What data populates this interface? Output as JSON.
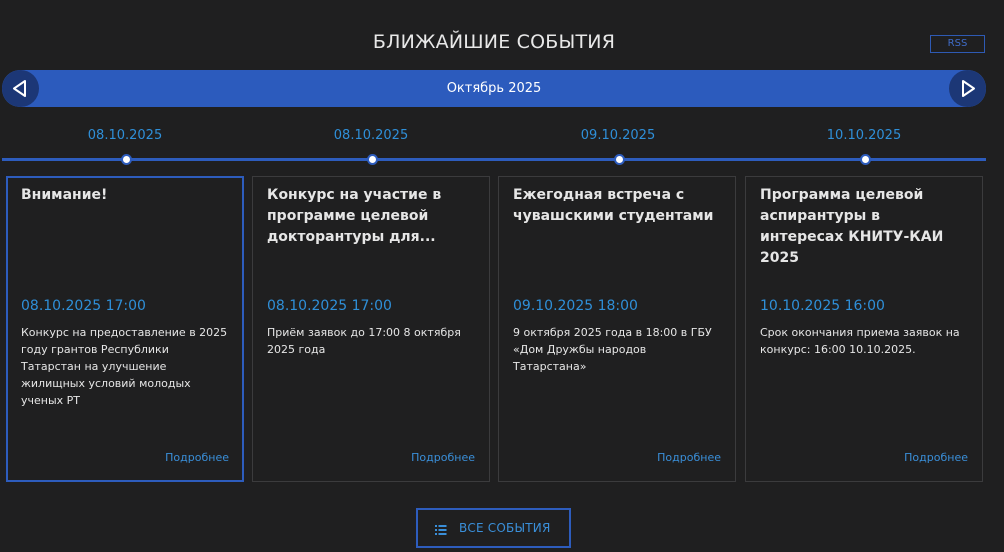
{
  "header": {
    "title": "БЛИЖАЙШИЕ СОБЫТИЯ",
    "rss_label": "RSS"
  },
  "month_bar": {
    "label": "Октябрь 2025",
    "prev_icon": "triangle-left-icon",
    "next_icon": "triangle-right-icon"
  },
  "timeline": {
    "dates": [
      "08.10.2025",
      "08.10.2025",
      "09.10.2025",
      "10.10.2025"
    ]
  },
  "events": [
    {
      "title": "Внимание!",
      "datetime": "08.10.2025 17:00",
      "description": "Конкурс на предоставление в 2025 году грантов Республики Татарстан на улучшение жилищных условий молодых ученых РТ",
      "more": "Подробнее"
    },
    {
      "title": "Конкурс на участие в программе целевой докторантуры для...",
      "datetime": "08.10.2025 17:00",
      "description": "Приём заявок до 17:00 8 октября 2025 года",
      "more": "Подробнее"
    },
    {
      "title": "Ежегодная встреча с чувашскими студентами",
      "datetime": "09.10.2025 18:00",
      "description": "9 октября 2025 года в 18:00 в ГБУ «Дом Дружбы народов Татарстана»",
      "more": "Подробнее"
    },
    {
      "title": "Программа целевой аспирантуры в интересах КНИТУ-КАИ 2025",
      "datetime": "10.10.2025 16:00",
      "description": "Срок окончания приема заявок на конкурс: 16:00 10.10.2025.",
      "more": "Подробнее"
    }
  ],
  "footer": {
    "all_events_label": "ВСЕ СОБЫТИЯ",
    "all_events_icon": "list-icon"
  },
  "colors": {
    "background": "#1f1f20",
    "accent": "#2c5bbd",
    "link": "#2f8fd8"
  }
}
